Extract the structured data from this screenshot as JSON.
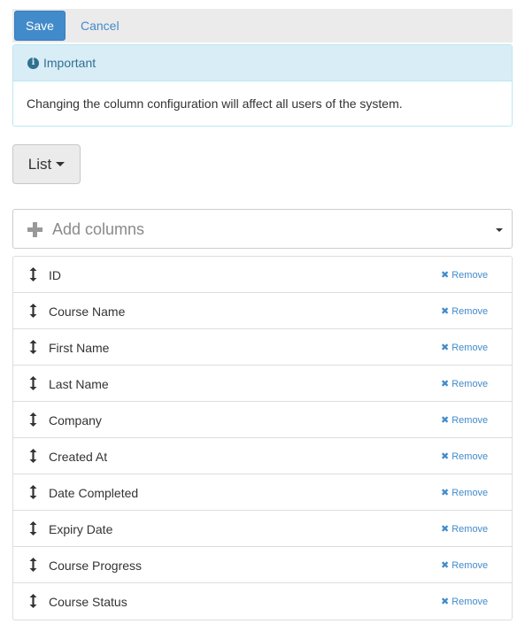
{
  "toolbar": {
    "save_label": "Save",
    "cancel_label": "Cancel"
  },
  "alert": {
    "icon": "info-circle-icon",
    "title": "Important",
    "message": "Changing the column configuration will affect all users of the system."
  },
  "view_selector": {
    "label": "List"
  },
  "add_columns": {
    "placeholder": "Add columns",
    "icon": "plus-icon"
  },
  "columns": [
    {
      "name": "ID",
      "remove_label": "Remove"
    },
    {
      "name": "Course Name",
      "remove_label": "Remove"
    },
    {
      "name": "First Name",
      "remove_label": "Remove"
    },
    {
      "name": "Last Name",
      "remove_label": "Remove"
    },
    {
      "name": "Company",
      "remove_label": "Remove"
    },
    {
      "name": "Created At",
      "remove_label": "Remove"
    },
    {
      "name": "Date Completed",
      "remove_label": "Remove"
    },
    {
      "name": "Expiry Date",
      "remove_label": "Remove"
    },
    {
      "name": "Course Progress",
      "remove_label": "Remove"
    },
    {
      "name": "Course Status",
      "remove_label": "Remove"
    }
  ],
  "colors": {
    "primary": "#428bca",
    "info_bg": "#d9edf7",
    "info_text": "#31708f",
    "toolbar_bg": "#ebebeb"
  }
}
